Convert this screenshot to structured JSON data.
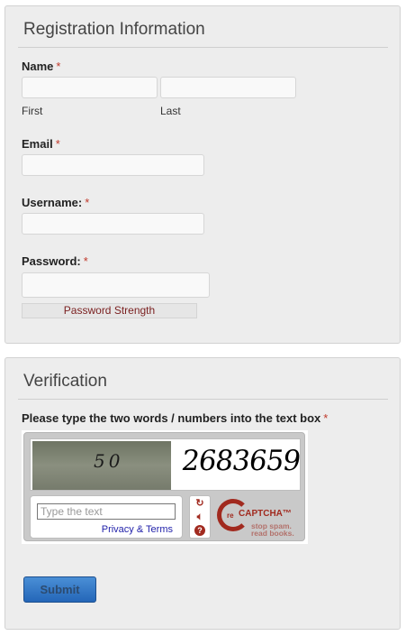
{
  "registration": {
    "title": "Registration Information",
    "name_label": "Name",
    "required_mark": "*",
    "first_sublabel": "First",
    "last_sublabel": "Last",
    "email_label": "Email",
    "username_label": "Username:",
    "password_label": "Password:",
    "password_strength": "Password Strength"
  },
  "verification": {
    "title": "Verification",
    "prompt": "Please type the two words / numbers into the text box",
    "captcha": {
      "word_left": "50",
      "word_right": "2683659",
      "input_placeholder": "Type the text",
      "privacy_terms": "Privacy & Terms",
      "logo_re": "re",
      "logo_name": "CAPTCHA™",
      "tagline_1": "stop spam.",
      "tagline_2": "read books."
    },
    "submit_label": "Submit"
  },
  "colors": {
    "required": "#c0392b",
    "recaptcha_brand": "#a12a1f",
    "submit_top": "#4a8fd6",
    "submit_bottom": "#2466b8"
  },
  "icons": {
    "refresh": "refresh-icon",
    "audio": "audio-icon",
    "help": "help-icon"
  }
}
